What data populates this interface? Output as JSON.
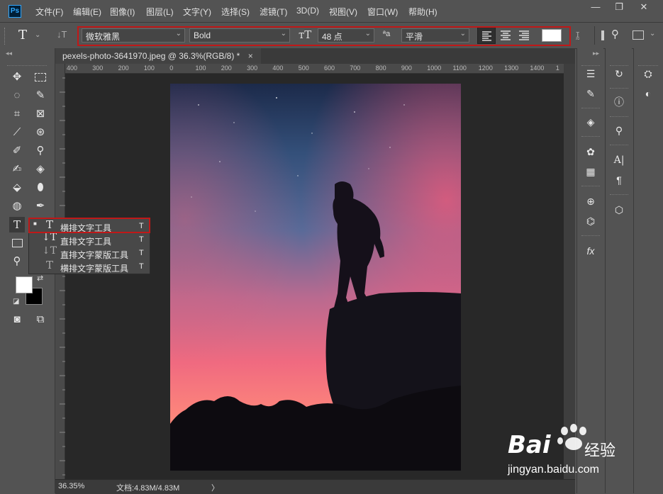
{
  "app": {
    "logo": "Ps"
  },
  "menu": [
    "文件(F)",
    "编辑(E)",
    "图像(I)",
    "图层(L)",
    "文字(Y)",
    "选择(S)",
    "滤镜(T)",
    "3D(D)",
    "视图(V)",
    "窗口(W)",
    "帮助(H)"
  ],
  "window_controls": {
    "minimize": "—",
    "restore": "❐",
    "close": "✕"
  },
  "options": {
    "font_family": "微软雅黑",
    "font_style": "Bold",
    "font_size": "48 点",
    "aa_label": "ªa",
    "antialias": "平滑",
    "text_color": "#ffffff"
  },
  "document": {
    "tab_title": "pexels-photo-3641970.jpeg @ 36.3%(RGB/8) *",
    "close": "×"
  },
  "ruler": {
    "ticks": [
      "400",
      "300",
      "200",
      "100",
      "0",
      "100",
      "200",
      "300",
      "400",
      "500",
      "600",
      "700",
      "800",
      "900",
      "1000",
      "1100",
      "1200",
      "1300",
      "1400",
      "1"
    ]
  },
  "flyout": {
    "items": [
      {
        "label": "横排文字工具",
        "shortcut": "T",
        "icon": "T"
      },
      {
        "label": "直排文字工具",
        "shortcut": "T",
        "icon": "↓T"
      },
      {
        "label": "直排文字蒙版工具",
        "shortcut": "T",
        "icon": "↓T"
      },
      {
        "label": "横排文字蒙版工具",
        "shortcut": "T",
        "icon": "T"
      }
    ]
  },
  "status": {
    "zoom": "36.35%",
    "doc": "文档:4.83M/4.83M",
    "arrow": "〉"
  },
  "colors": {
    "foreground": "#ffffff",
    "background": "#000000",
    "highlight": "#c01818"
  },
  "watermark": {
    "brand": "Bai",
    "brand2": "经验",
    "url": "jingyan.baidu.com"
  }
}
